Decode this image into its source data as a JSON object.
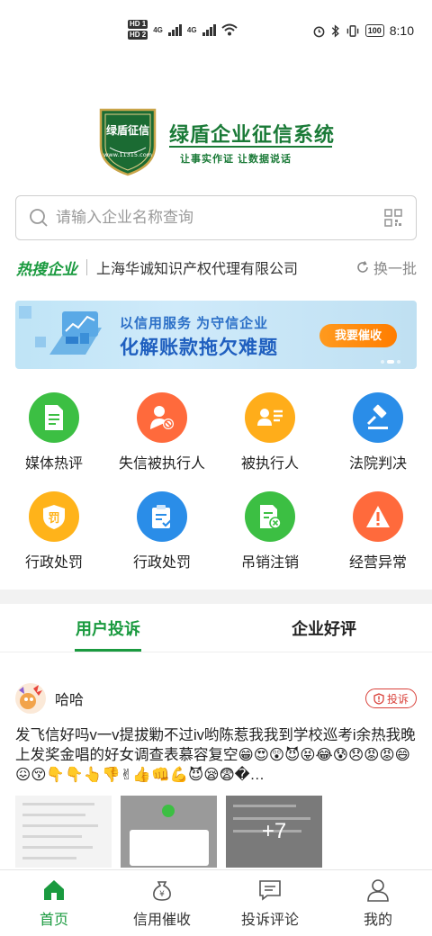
{
  "statusbar": {
    "hd1": "HD 1",
    "hd2": "HD 2",
    "net1": "4G",
    "net2": "4G",
    "battery": "100",
    "time": "8:10"
  },
  "logo": {
    "shield_text": "绿盾征信",
    "shield_url": "www.11315.com",
    "title": "绿盾企业征信系统",
    "subtitle": "让事实作证  让数据说话"
  },
  "search": {
    "placeholder": "请输入企业名称查询"
  },
  "hot": {
    "label": "热搜企业",
    "company": "上海华诚知识产权代理有限公司",
    "refresh": "换一批"
  },
  "banner": {
    "line1": "以信用服务  为守信企业",
    "line2": "化解账款拖欠难题",
    "button": "我要催收"
  },
  "grid": [
    {
      "label": "媒体热评",
      "color": "#3cbf43",
      "icon": "document-icon"
    },
    {
      "label": "失信被执行人",
      "color": "#ff6a3c",
      "icon": "person-ban-icon"
    },
    {
      "label": "被执行人",
      "color": "#ffad1a",
      "icon": "person-card-icon"
    },
    {
      "label": "法院判决",
      "color": "#2a8de8",
      "icon": "gavel-icon"
    },
    {
      "label": "行政处罚",
      "color": "#ffb31a",
      "icon": "penalty-shield-icon"
    },
    {
      "label": "行政处罚",
      "color": "#2a8de8",
      "icon": "clipboard-check-icon"
    },
    {
      "label": "吊销注销",
      "color": "#3cbf43",
      "icon": "doc-revoke-icon"
    },
    {
      "label": "经营异常",
      "color": "#ff6a3c",
      "icon": "warning-icon"
    }
  ],
  "tabs": [
    {
      "label": "用户投诉",
      "active": true
    },
    {
      "label": "企业好评",
      "active": false
    }
  ],
  "post": {
    "user": "哈哈",
    "badge": "投诉",
    "text": "发飞信好吗v一v提拔勦不过iv哟陈惹我我到学校巡考i余热我晚上发奖金唱的好女调查表慕容复空",
    "emojis": "😁😍😲😈😝😂😰😞😡😡😄😖😚👇👇👆👎✌👍👊💪😈😪😨�…",
    "more_count": "+7"
  },
  "bottomnav": [
    {
      "label": "首页",
      "icon": "home-icon",
      "active": true
    },
    {
      "label": "信用催收",
      "icon": "money-bag-icon",
      "active": false
    },
    {
      "label": "投诉评论",
      "icon": "comment-icon",
      "active": false
    },
    {
      "label": "我的",
      "icon": "user-icon",
      "active": false
    }
  ],
  "colors": {
    "brand_green": "#1a9a3f",
    "logo_green": "#1a7a37",
    "alert_red": "#d9413a"
  }
}
